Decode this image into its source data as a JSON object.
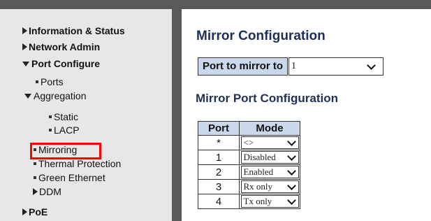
{
  "sidebar": {
    "items": [
      {
        "label": "Information & Status",
        "icon": "triangle-right-icon"
      },
      {
        "label": "Network Admin",
        "icon": "triangle-right-icon"
      },
      {
        "label": "Port Configure",
        "icon": "triangle-down-icon"
      },
      {
        "label": "Ports",
        "icon": "bullet-icon"
      },
      {
        "label": "Aggregation",
        "icon": "triangle-down-icon"
      },
      {
        "label": "Static",
        "icon": "bullet-icon"
      },
      {
        "label": "LACP",
        "icon": "bullet-icon"
      },
      {
        "label": "Mirroring",
        "icon": "bullet-icon"
      },
      {
        "label": "Thermal Protection",
        "icon": "bullet-icon"
      },
      {
        "label": "Green Ethernet",
        "icon": "bullet-icon"
      },
      {
        "label": "DDM",
        "icon": "triangle-right-icon"
      },
      {
        "label": "PoE",
        "icon": "triangle-right-icon"
      }
    ],
    "selected": "Mirroring",
    "highlight_color": "#ff0000"
  },
  "main": {
    "title": "Mirror Configuration",
    "port_to_mirror_to": {
      "label": "Port to mirror to",
      "value": "1"
    },
    "section_title": "Mirror Port Configuration",
    "table": {
      "headers": [
        "Port",
        "Mode"
      ],
      "rows": [
        {
          "port": "*",
          "mode": "<>"
        },
        {
          "port": "1",
          "mode": "Disabled"
        },
        {
          "port": "2",
          "mode": "Enabled"
        },
        {
          "port": "3",
          "mode": "Rx only"
        },
        {
          "port": "4",
          "mode": "Tx only"
        }
      ]
    }
  },
  "colors": {
    "header_bar": "#595959",
    "sidebar_bg": "#e7e7e7",
    "table_header_bg": "#c9d8ea",
    "title_color": "#1f2f57"
  }
}
